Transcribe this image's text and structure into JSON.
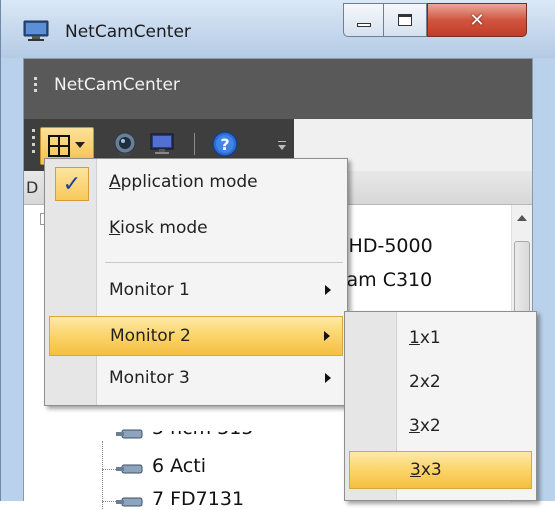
{
  "window": {
    "title": "NetCamCenter",
    "icon": "monitor-icon"
  },
  "app_header": {
    "title": "NetCamCenter"
  },
  "toolbar": {
    "buttons": [
      {
        "name": "layout-grid-icon"
      },
      {
        "name": "webcam-icon"
      },
      {
        "name": "monitor-icon"
      },
      {
        "name": "help-icon"
      }
    ]
  },
  "panel": {
    "header_text": "D",
    "tree": {
      "items": [
        {
          "label": "m HD-5000"
        },
        {
          "label": "pcam C310"
        },
        {
          "label": "5 ncm 315"
        },
        {
          "label": "6 Acti"
        },
        {
          "label": "7 FD7131"
        }
      ]
    }
  },
  "menu": {
    "items": [
      {
        "prefix": "",
        "ul": "A",
        "rest": "pplication mode",
        "checked": true
      },
      {
        "prefix": "",
        "ul": "K",
        "rest": "iosk mode",
        "checked": false
      },
      {
        "label": "Monitor 1",
        "has_submenu": true
      },
      {
        "label": "Monitor 2",
        "has_submenu": true,
        "highlighted": true
      },
      {
        "label": "Monitor 3",
        "has_submenu": true
      }
    ]
  },
  "submenu": {
    "items": [
      {
        "ul": "1",
        "rest": "x1"
      },
      {
        "ul": "",
        "rest": "2x2"
      },
      {
        "ul": "3",
        "rest": "x2"
      },
      {
        "ul": "3",
        "rest": "x3",
        "highlighted": true
      }
    ]
  },
  "colors": {
    "menu_highlight": "#fbd46a",
    "header_bg": "#595959",
    "toolbar_bg": "#3e3e3e"
  }
}
